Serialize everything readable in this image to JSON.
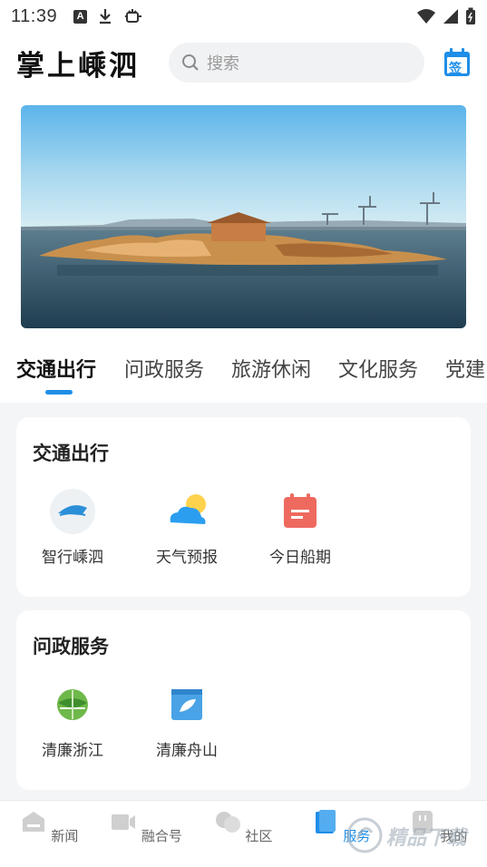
{
  "status_bar": {
    "time": "11:39",
    "a_badge": "A"
  },
  "header": {
    "logo_text": "掌上嵊泗",
    "search_placeholder": "搜索",
    "sign_label": "签"
  },
  "tabs": [
    {
      "label": "交通出行"
    },
    {
      "label": "问政服务"
    },
    {
      "label": "旅游休闲"
    },
    {
      "label": "文化服务"
    },
    {
      "label": "党建"
    }
  ],
  "sections": [
    {
      "title": "交通出行",
      "items": [
        {
          "label": "智行嵊泗",
          "icon": "ferry-logo-icon",
          "badge": "智行嵊泗"
        },
        {
          "label": "天气预报",
          "icon": "weather-icon"
        },
        {
          "label": "今日船期",
          "icon": "calendar-icon"
        }
      ]
    },
    {
      "title": "问政服务",
      "items": [
        {
          "label": "清廉浙江",
          "icon": "integrity-zhejiang-icon"
        },
        {
          "label": "清廉舟山",
          "icon": "integrity-zhoushan-icon"
        }
      ]
    }
  ],
  "bottom_nav": [
    {
      "label": "新闻",
      "icon": "news-icon"
    },
    {
      "label": "融合号",
      "icon": "video-icon"
    },
    {
      "label": "社区",
      "icon": "community-icon"
    },
    {
      "label": "服务",
      "icon": "service-icon",
      "active": true
    },
    {
      "label": "我的",
      "icon": "profile-icon"
    }
  ],
  "watermark": "精品下载",
  "colors": {
    "accent": "#1f8ee8",
    "background": "#f4f5f7",
    "card": "#ffffff",
    "calendar": "#ee6a5f",
    "sun": "#ffd24d",
    "cloud": "#2b9ef0"
  }
}
